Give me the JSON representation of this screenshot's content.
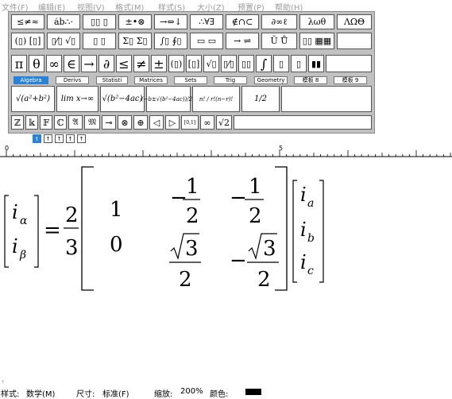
{
  "menu": [
    "文件(F)",
    "编辑(E)",
    "视图(V)",
    "格式(M)",
    "样式(S)",
    "大小(Z)",
    "预置(P)",
    "帮助(H)"
  ],
  "palette_row1": [
    "≤≠≈",
    "ȧb∴·",
    "▯▯ ▯",
    "±•⊗",
    "→⇔↓",
    "∴∀∃",
    "∉∩⊂",
    "∂∞ℓ",
    "λωθ",
    "ΛΩΘ"
  ],
  "palette_row2": [
    "(▯) [▯]",
    "▯⁄▯ √▯",
    "▯ ▯",
    "Σ▯ Σ▯",
    "∫▯ ∮▯",
    "▭ ▭",
    "→ ⇌",
    "Ū Ů",
    "▯▯ ▦▦",
    ""
  ],
  "palette_row3": [
    "π",
    "θ",
    "∞",
    "∈",
    "→",
    "∂",
    "≤",
    "≠",
    "±",
    "(▯)",
    "[▯]",
    "√▯",
    "▯⁄▯",
    "▯▯",
    "∫",
    "▯",
    "▯",
    "▮▮"
  ],
  "tabs": [
    "Algebra",
    "Derivs",
    "Statisti",
    "Matrices",
    "Sets",
    "Trig",
    "Geometry",
    "模板 8",
    "模板 9"
  ],
  "templates": [
    "√(a²+b²)",
    "lim x→∞",
    "√(b²−4ac)",
    "(−b±√(b²−4ac))/2a",
    "n! / r!(n−r)!",
    "1/2"
  ],
  "symbols_row": [
    "ℤ",
    "𝕜",
    "𝔽",
    "ℂ",
    "𝔄",
    "𝔐",
    "⊸",
    "⊗",
    "⊕",
    "◁",
    "▷",
    "[0,1]",
    "∞",
    "√2"
  ],
  "tabstrip": [
    "t",
    "↑",
    "↑",
    "↑",
    "↑"
  ],
  "ruler": {
    "start": "0",
    "mid": "5"
  },
  "equation": {
    "lhs": [
      {
        "var": "i",
        "sub": "α"
      },
      {
        "var": "i",
        "sub": "β"
      }
    ],
    "equals": "=",
    "coef_num": "2",
    "coef_den": "3",
    "matrix": {
      "r1c1": "1",
      "r2c1": "0",
      "r1c2_sign": "−",
      "r1c2_num": "1",
      "r1c2_den": "2",
      "r1c3_sign": "−",
      "r1c3_num": "1",
      "r1c3_den": "2",
      "r2c2_num": "3",
      "r2c2_den": "2",
      "r2c3_sign": "−",
      "r2c3_num": "3",
      "r2c3_den": "2"
    },
    "rhs": [
      {
        "var": "i",
        "sub": "a"
      },
      {
        "var": "i",
        "sub": "b"
      },
      {
        "var": "i",
        "sub": "c"
      }
    ]
  },
  "status": {
    "style_label": "样式:",
    "style_value": "数学(M)",
    "size_label": "尺寸:",
    "size_value": "标准(F)",
    "zoom_label": "缩放:",
    "zoom_value": "200%",
    "color_label": "颜色:",
    "color_value": "#000000"
  }
}
